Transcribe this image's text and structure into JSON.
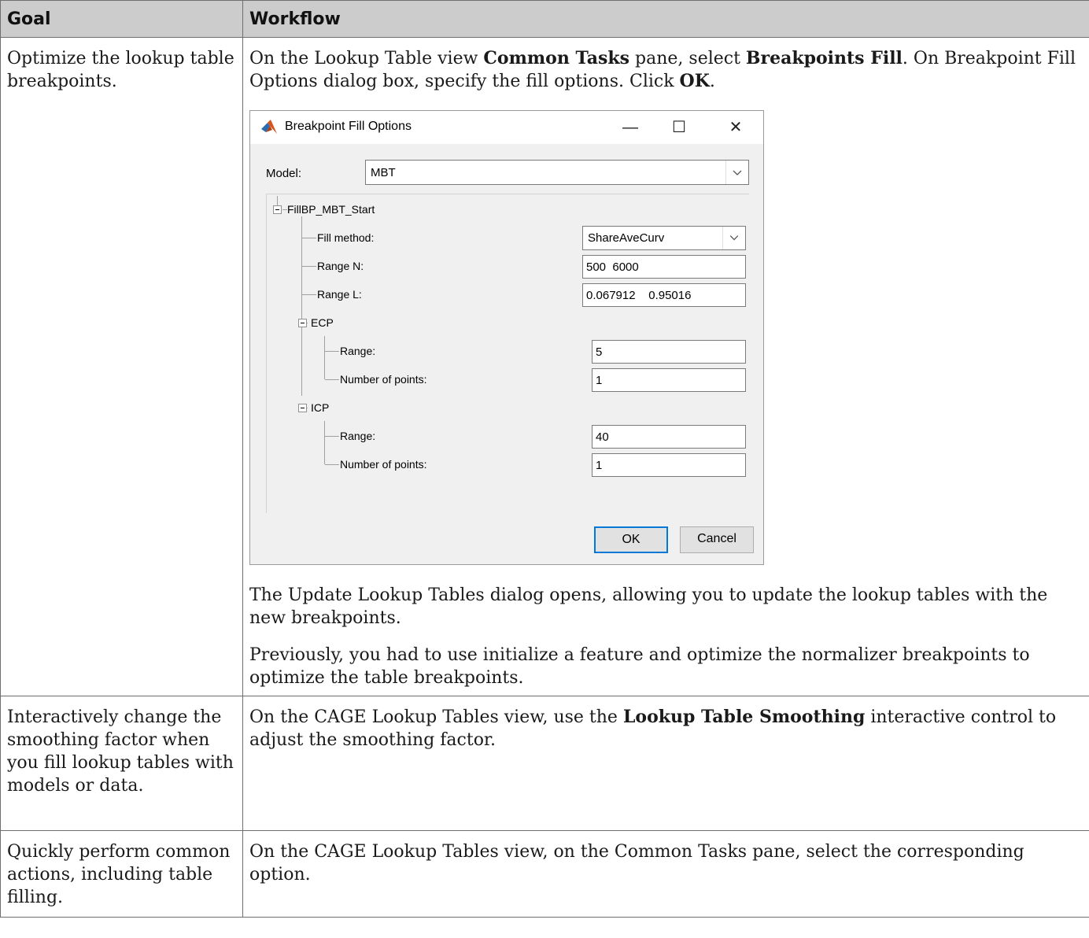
{
  "table": {
    "headers": {
      "goal": "Goal",
      "workflow": "Workflow"
    },
    "rows": [
      {
        "goal": "Optimize the lookup table breakpoints.",
        "p1": {
          "t1": "On the Lookup Table view ",
          "b1": "Common Tasks",
          "t2": " pane, select ",
          "b2": "Breakpoints Fill",
          "t3": ". On Breakpoint Fill Options dialog box, specify the fill options. Click ",
          "b3": "OK",
          "t4": "."
        },
        "p2": "The Update Lookup Tables dialog opens, allowing you to update the lookup tables with the new breakpoints.",
        "p3": "Previously, you had to use initialize a feature and optimize the normalizer breakpoints to optimize the table breakpoints."
      },
      {
        "goal": "Interactively change the smoothing factor when you fill lookup tables with models or data.",
        "p1": {
          "t1": "On the CAGE Lookup Tables view, use the ",
          "b1": "Lookup Table Smoothing",
          "t2": " interactive control to adjust the smoothing factor."
        }
      },
      {
        "goal": "Quickly perform common actions, including table filling.",
        "p1": "On the CAGE Lookup Tables view, on the Common Tasks pane, select the corresponding option."
      }
    ]
  },
  "dialog": {
    "title": "Breakpoint Fill Options",
    "window_buttons": {
      "minimize": "—",
      "maximize": "☐",
      "close": "✕"
    },
    "model_label": "Model:",
    "model_value": "MBT",
    "tree": {
      "root": "FillBP_MBT_Start",
      "fill_method_label": "Fill method:",
      "fill_method_value": "ShareAveCurv",
      "range_n_label": "Range N:",
      "range_n_value": "500  6000",
      "range_l_label": "Range L:",
      "range_l_value": "0.067912    0.95016",
      "ecp": {
        "label": "ECP",
        "range_label": "Range:",
        "range_value": "5",
        "points_label": "Number of points:",
        "points_value": "1"
      },
      "icp": {
        "label": "ICP",
        "range_label": "Range:",
        "range_value": "40",
        "points_label": "Number of points:",
        "points_value": "1"
      }
    },
    "ok_label": "OK",
    "cancel_label": "Cancel",
    "colors": {
      "matlab_orange": "#d9531e",
      "matlab_blue": "#2b6cb0",
      "default_button_border": "#0078d7"
    }
  }
}
